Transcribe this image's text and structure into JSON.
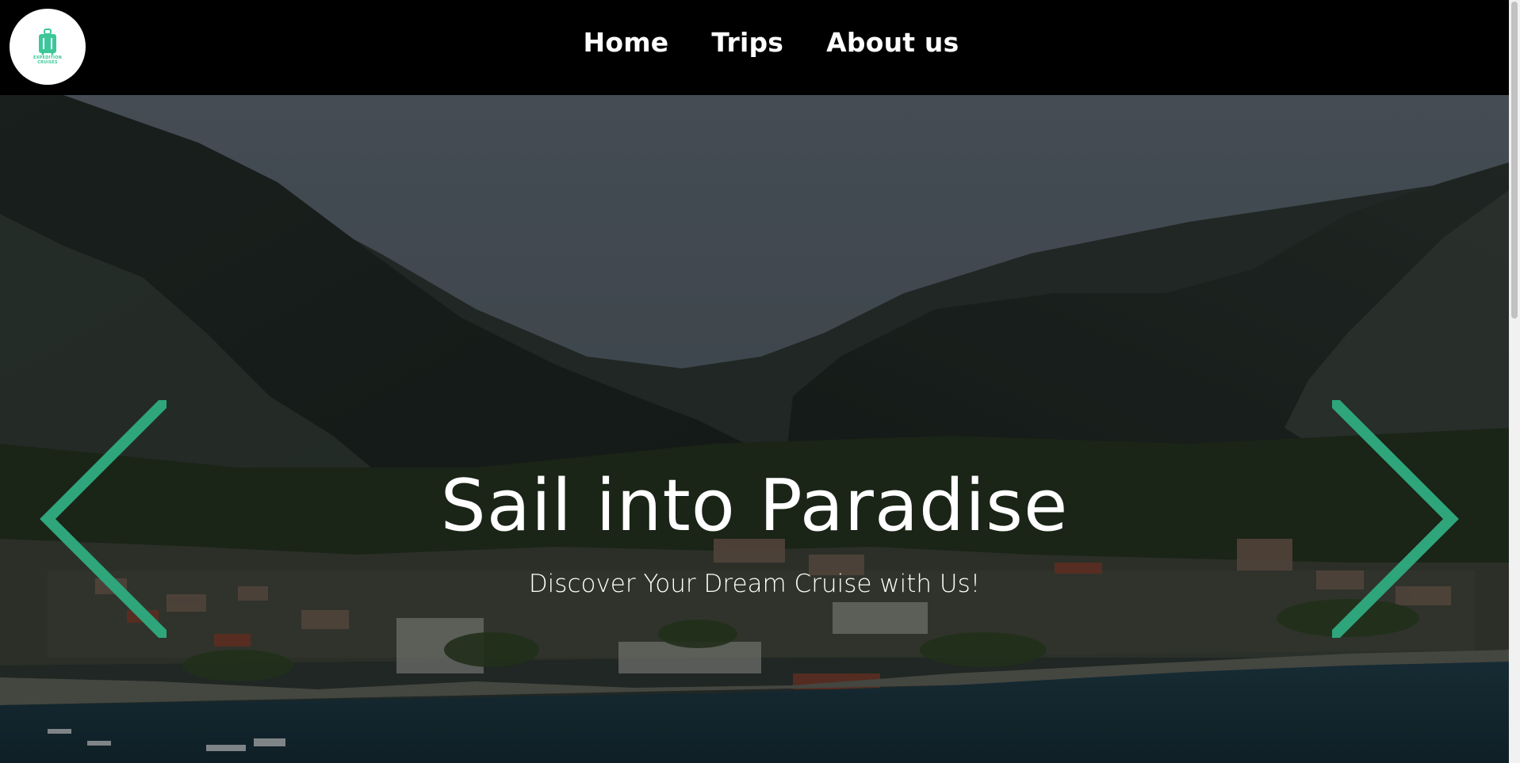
{
  "header": {
    "logo": {
      "text_line1": "EXPEDITION",
      "text_line2": "CRUISES",
      "icon": "suitcase-icon",
      "color": "#3cc79a"
    },
    "nav": [
      {
        "label": "Home"
      },
      {
        "label": "Trips"
      },
      {
        "label": "About us"
      }
    ]
  },
  "hero": {
    "title": "Sail into Paradise",
    "subtitle": "Discover Your Dream Cruise with Us!",
    "prev_icon": "chevron-left-icon",
    "next_icon": "chevron-right-icon",
    "accent_color": "#2fa57c"
  }
}
